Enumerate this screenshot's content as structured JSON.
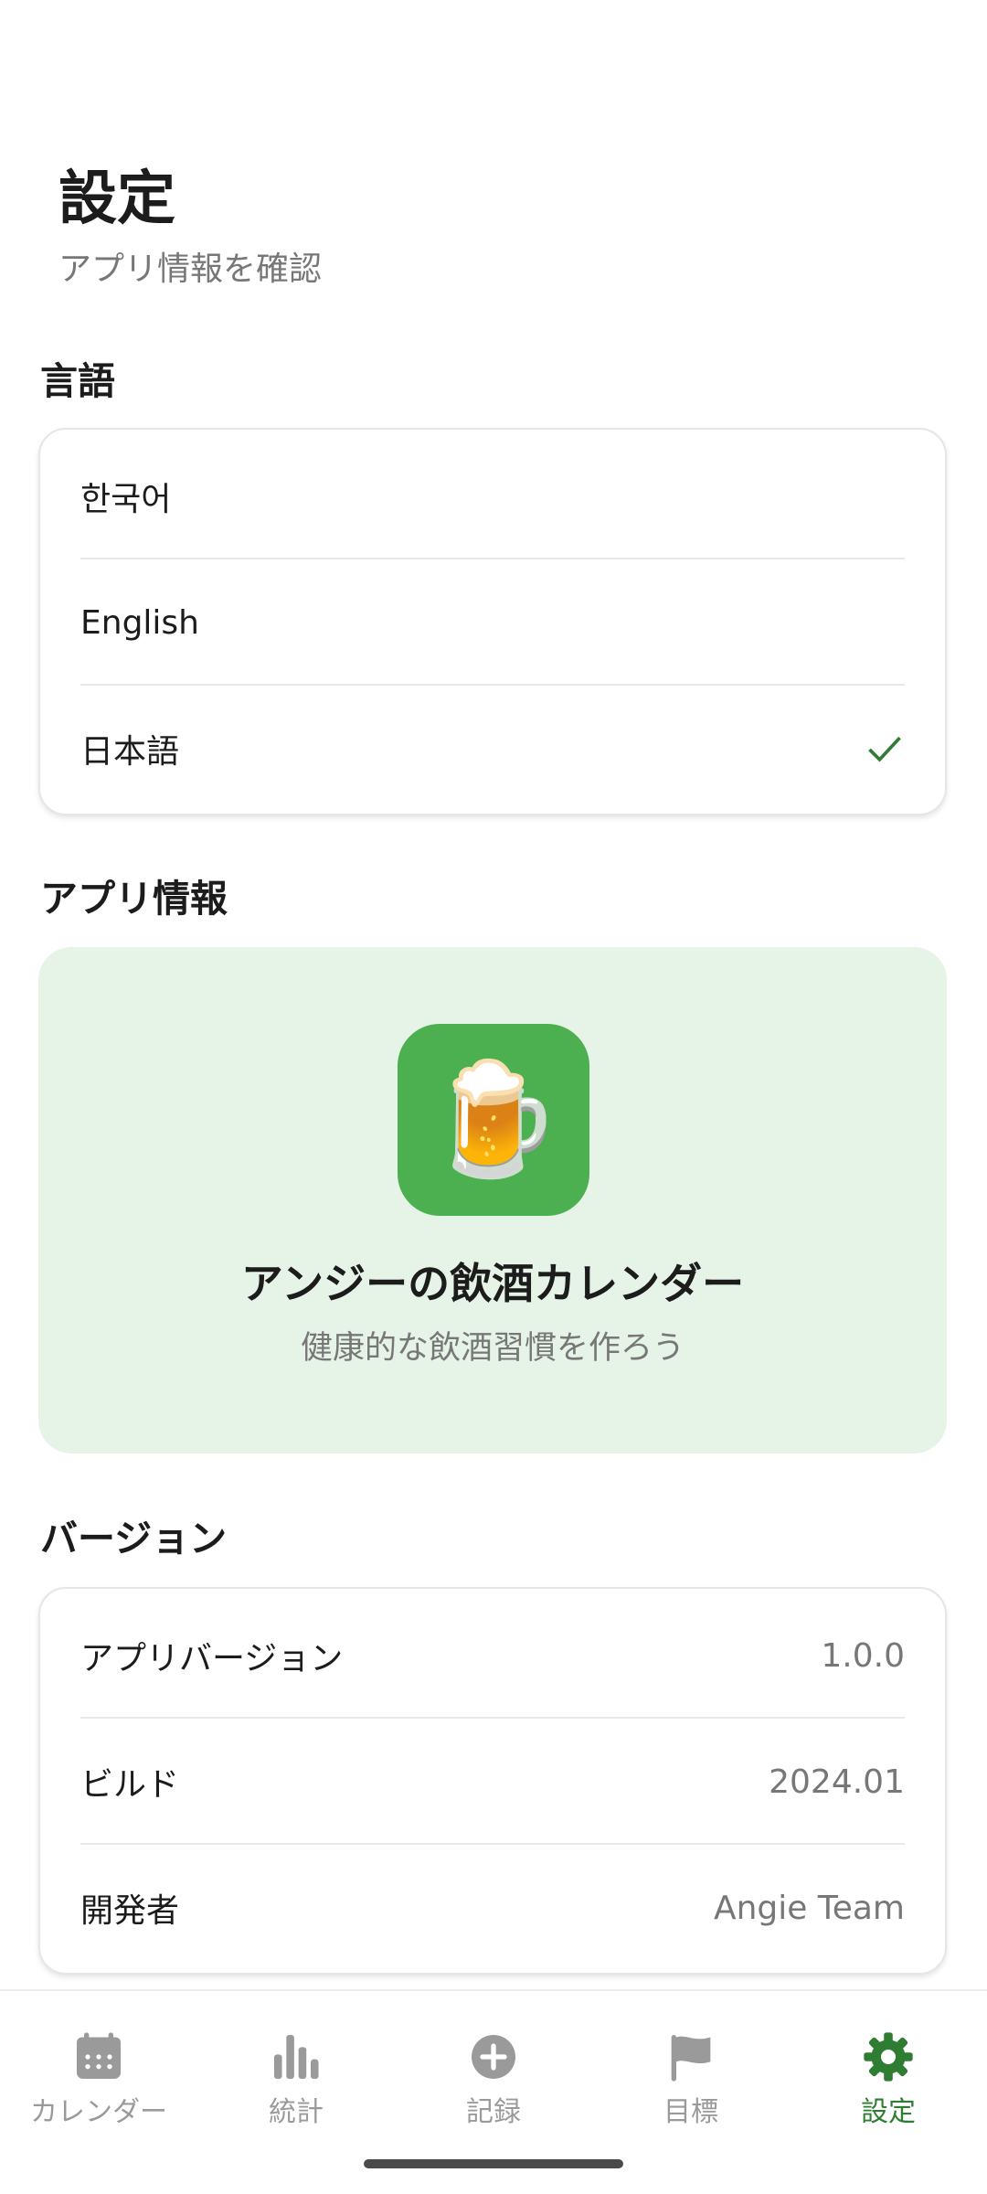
{
  "header": {
    "title": "設定",
    "subtitle": "アプリ情報を確認"
  },
  "language_section": {
    "title": "言語",
    "options": [
      {
        "label": "한국어",
        "selected": false
      },
      {
        "label": "English",
        "selected": false
      },
      {
        "label": "日本語",
        "selected": true
      }
    ],
    "check_icon": "check-icon"
  },
  "app_info_section": {
    "title": "アプリ情報",
    "icon": "beer-mug-icon",
    "icon_glyph": "🍺",
    "app_name": "アンジーの飲酒カレンダー",
    "tagline": "健康的な飲酒習慣を作ろう"
  },
  "version_section": {
    "title": "バージョン",
    "rows": [
      {
        "label": "アプリバージョン",
        "value": "1.0.0"
      },
      {
        "label": "ビルド",
        "value": "2024.01"
      },
      {
        "label": "開発者",
        "value": "Angie Team"
      }
    ]
  },
  "bottom_nav": {
    "items": [
      {
        "label": "カレンダー",
        "icon": "calendar-icon",
        "active": false
      },
      {
        "label": "統計",
        "icon": "bar-chart-icon",
        "active": false
      },
      {
        "label": "記録",
        "icon": "add-circle-icon",
        "active": false
      },
      {
        "label": "目標",
        "icon": "flag-icon",
        "active": false
      },
      {
        "label": "設定",
        "icon": "gear-icon",
        "active": true
      }
    ]
  },
  "colors": {
    "accent": "#2e7d32",
    "app_icon_bg": "#4caf50",
    "info_card_bg": "#e6f4e8",
    "muted_text": "#777777"
  }
}
